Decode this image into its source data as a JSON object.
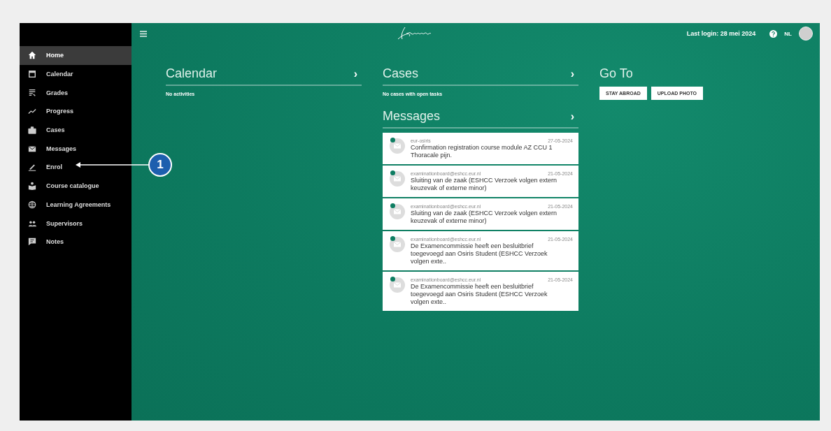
{
  "sidebar": {
    "items": [
      {
        "label": "Home",
        "selected": true
      },
      {
        "label": "Calendar",
        "selected": false
      },
      {
        "label": "Grades",
        "selected": false
      },
      {
        "label": "Progress",
        "selected": false
      },
      {
        "label": "Cases",
        "selected": false
      },
      {
        "label": "Messages",
        "selected": false
      },
      {
        "label": "Enrol",
        "selected": false
      },
      {
        "label": "Course catalogue",
        "selected": false
      },
      {
        "label": "Learning Agreements",
        "selected": false
      },
      {
        "label": "Supervisors",
        "selected": false
      },
      {
        "label": "Notes",
        "selected": false
      }
    ]
  },
  "top_bar": {
    "last_login": "Last login: 28 mei 2024",
    "language": "NL"
  },
  "calendar": {
    "title": "Calendar",
    "chevron": "›",
    "empty_text": "No activities"
  },
  "cases": {
    "title": "Cases",
    "chevron": "›",
    "empty_text": "No cases with open tasks"
  },
  "messages": {
    "title": "Messages",
    "chevron": "›",
    "items": [
      {
        "sender": "eur-osiris",
        "date": "27-05-2024",
        "subject": "Confirmation registration course module AZ CCU 1 Thoracale pijn.",
        "unread": true
      },
      {
        "sender": "examinationboard@eshcc.eur.nl",
        "date": "21-05-2024",
        "subject": "Sluiting van de zaak (ESHCC Verzoek volgen extern keuzevak of externe minor)",
        "unread": true
      },
      {
        "sender": "examinationboard@eshcc.eur.nl",
        "date": "21-05-2024",
        "subject": "Sluiting van de zaak (ESHCC Verzoek volgen extern keuzevak of externe minor)",
        "unread": true
      },
      {
        "sender": "examinationboard@eshcc.eur.nl",
        "date": "21-05-2024",
        "subject": "De Examencommissie heeft een besluitbrief toegevoegd aan Osiris Student (ESHCC Verzoek volgen exte..",
        "unread": true
      },
      {
        "sender": "examinationboard@eshcc.eur.nl",
        "date": "21-05-2024",
        "subject": "De Examencommissie heeft een besluitbrief toegevoegd aan Osiris Student (ESHCC Verzoek volgen exte..",
        "unread": true
      }
    ]
  },
  "go_to": {
    "title": "Go To",
    "buttons": [
      "STAY ABROAD",
      "UPLOAD PHOTO"
    ]
  },
  "callout": {
    "number": "1"
  }
}
